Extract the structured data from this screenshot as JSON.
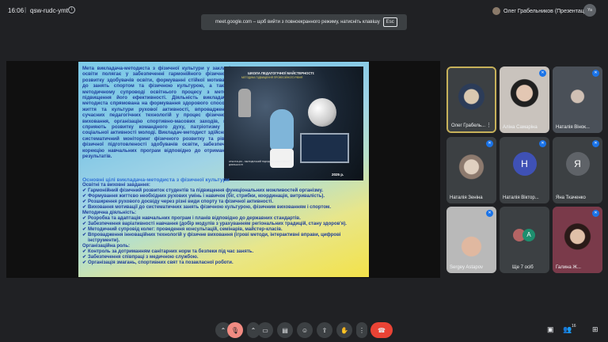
{
  "top": {
    "time": "16:06",
    "separator": "|",
    "meeting_code": "qsw-rudc-ymt",
    "info_icon": "info-icon",
    "presenter_label": "Олег Грабельников (Презентація)",
    "self_badge": "Ya"
  },
  "banner": {
    "text": "meet.google.com – щоб вийти з повноекранного режиму, натисніть клавішу",
    "key": "Esc"
  },
  "slide": {
    "paragraph": "Мета викладача-методиста з фізичної культури у закладі освіти полягає у забезпеченні гармонійного фізичного розвитку здобувачів освіти, формуванні стійкої мотивації до занять спортом та фізичною культурою, а також методичному супроводі освітнього процесу з метою підвищення його ефективності. Діяльність викладача-методиста спрямована на формування здорового способу життя та культури рухової активності, впровадження сучасних педагогічних технологій у процес фізичного виховання, організацію спортивно-масових заходів, що сприяють розвитку командного духу, патріотизму та соціальної активності молоді. Викладач-методист здійснює систематичний моніторинг фізичного розвитку та рівня фізичної підготовленості здобувачів освіти, забезпечує корекцію навчальних програм відповідно до отриманих результатів.",
    "photo_title": "ШКОЛА ПЕДАГОГІЧНОЇ МАЙСТЕРНОСТІ:",
    "photo_subtitle": "МЕТОДИКА ПІДВИЩЕННЯ ПРОФЕСІЙНОГО РІВНЯ",
    "photo_small": "АТЕСТАЦІЯ – МЕТОДИЧНИЙ ПІДХІД ДО ЕФЕКТИВНОЇ ДІЯЛЬНОСТІ",
    "photo_year": "2025 р.",
    "section_heading": "Основні цілі викладача-методиста з фізичної культури",
    "group1_title": "Освітні та виховні завдання:",
    "group1": [
      "Гармонійний фізичний розвиток студентів та підвищення функціональних можливостей організму.",
      "Формування життєво необхідних рухових умінь і навичок (біг, стрибки, координація, витривалість).",
      "Розширення рухового досвіду через різні види спорту та фізичної активності.",
      "Виховання мотивації до систематичних занять фізичною культурою, фізичним вихованням і спортом."
    ],
    "group2_title": "Методична діяльність:",
    "group2": [
      "Розробка та адаптація навчальних програм і планів відповідно до державних стандартів.",
      "Забезпечення варіативності навчання (добір модулів з урахуванням регіональних традицій, стану здоров'я).",
      "Методичний супровід колег: проведення консультацій, семінарів, майстер-класів.",
      "Впровадження інноваційних технологій у фізичне виховання (ігрові методи, інтерактивні вправи, цифрові інструменти)."
    ],
    "group3_title": "Організаційна роль:",
    "group3": [
      "Контроль за дотриманням санітарних норм та безпеки під час занять.",
      "Забезпечення співпраці з медичною службою.",
      "Організація змагань, спортивних свят та позакласної роботи."
    ]
  },
  "participants": [
    {
      "name": "Олег Грабель...",
      "kind": "photo",
      "color": "#6b4a2a"
    },
    {
      "name": "Аліна Самаріна",
      "kind": "photo",
      "color": "#8b6a5a"
    },
    {
      "name": "Наталія Вінок...",
      "kind": "photo",
      "color": "#57606a"
    },
    {
      "name": "Наталія Зеніна",
      "kind": "photo",
      "color": "#8d7a6e"
    },
    {
      "name": "Наталія Віктор...",
      "kind": "letter",
      "letter": "Н",
      "color": "#3f51b5"
    },
    {
      "name": "Яна Ткаченко",
      "kind": "letter",
      "letter": "Я",
      "color": "#5f6368"
    },
    {
      "name": "Sergey Astapov",
      "kind": "photo",
      "color": "#b9b9b9"
    },
    {
      "name": "Ще 7 осіб",
      "kind": "more",
      "color": "#3c4043"
    },
    {
      "name": "Галина Ж...",
      "kind": "photo",
      "color": "#7a3a4a"
    }
  ],
  "controls": {
    "mic_icon": "mic-off-icon",
    "cam_icon": "camera-icon",
    "captions_icon": "captions-icon",
    "emoji_icon": "emoji-icon",
    "present_icon": "present-icon",
    "hand_icon": "raise-hand-icon",
    "more_icon": "more-options-icon",
    "leave_icon": "leave-call-icon",
    "chat_icon": "chat-icon",
    "people_icon": "people-icon",
    "people_count": "16",
    "activities_icon": "activities-icon"
  }
}
